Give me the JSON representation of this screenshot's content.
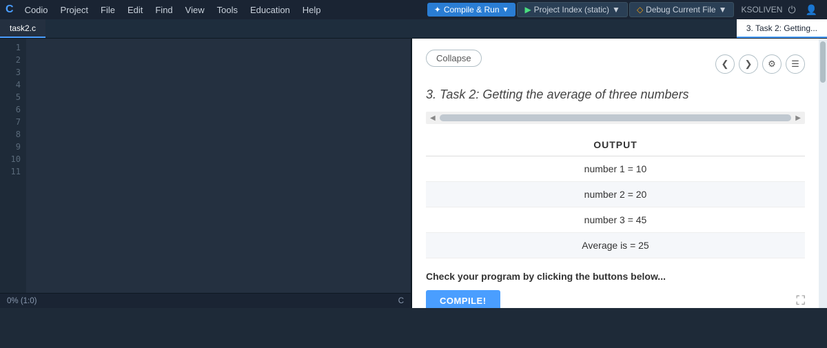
{
  "app": {
    "logo": "C",
    "brand": "Codio"
  },
  "menubar": {
    "items": [
      "Codio",
      "Project",
      "File",
      "Edit",
      "Find",
      "View",
      "Tools",
      "Education",
      "Help"
    ]
  },
  "toolbar": {
    "compile_run_label": "Compile & Run",
    "project_index_label": "Project Index (static)",
    "debug_label": "Debug Current File",
    "user": "KSOLIVEN"
  },
  "tabs": {
    "left": "task2.c",
    "right": "3. Task 2: Getting..."
  },
  "editor": {
    "line_numbers": [
      1,
      2,
      3,
      4,
      5,
      6,
      7,
      8,
      9,
      10,
      11
    ],
    "status_left": "0% (1:0)",
    "status_right": "C"
  },
  "right_panel": {
    "collapse_btn": "Collapse",
    "task_title": "3. Task 2: Getting the average of three numbers",
    "output_header": "OUTPUT",
    "output_rows": [
      "number 1 = 10",
      "number 2 = 20",
      "number 3 = 45",
      "Average is = 25"
    ],
    "check_text": "Check your program by clicking the buttons below...",
    "compile_btn": "COMPILE!"
  },
  "icons": {
    "left_arrow": "◀",
    "right_arrow": "▶",
    "settings": "⚙",
    "menu": "☰",
    "chevron_left": "❮",
    "chevron_right": "❯",
    "fullscreen": "⛶",
    "power": "⏻",
    "person": "👤",
    "compile_play": "▶",
    "project_arrow": "▶",
    "debug_diamond": "◇"
  },
  "colors": {
    "accent_blue": "#4a9eff",
    "menubar_bg": "#1a2433",
    "editor_bg": "#243040",
    "right_bg": "#ffffff"
  }
}
